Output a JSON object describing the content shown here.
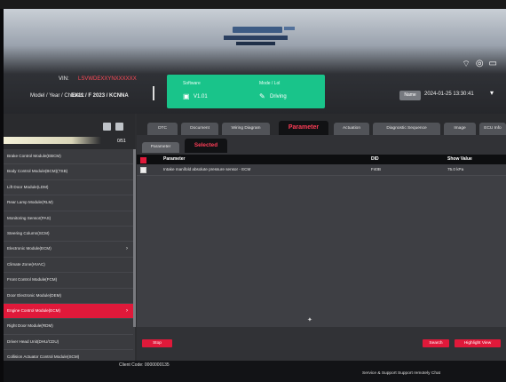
{
  "header": {
    "vin_label": "VIN:",
    "vin_value": "LSVWDEXXYNXXXXXX",
    "model_label": "Model / Year / Chassis:",
    "model_value": "EX11 / F 2023 / KCNNA",
    "system_icons": [
      "wifi-icon",
      "camera-icon",
      "battery-icon"
    ],
    "sys_text": "Ⓐ ◎ ▭"
  },
  "status_panel": {
    "software_title": "Software",
    "software_value": "V1.01",
    "mode_title": "Mode / Lol",
    "mode_value": "Driving",
    "color": "#19c48a"
  },
  "datetime": {
    "name_button": "Name",
    "value": "2024-01-25 13:30:41"
  },
  "left_panel": {
    "count": "0/51",
    "modules": [
      {
        "label": "Brake Control Module(EBCM)",
        "selected": false
      },
      {
        "label": "Body Control Module(BCM)(TSB)",
        "selected": false
      },
      {
        "label": "Lift Door Module(LDM)",
        "selected": false
      },
      {
        "label": "Rear Lamp Module(RLM)",
        "selected": false
      },
      {
        "label": "Monitoring Sensor(PAS)",
        "selected": false
      },
      {
        "label": "Steering Column(SCM)",
        "selected": false
      },
      {
        "label": "Electronic Module(ECM)",
        "selected": false
      },
      {
        "label": "Climate Zone(HVAC)",
        "selected": false
      },
      {
        "label": "Front Control Module(FCM)",
        "selected": false
      },
      {
        "label": "Door Electronic Module(DEM)",
        "selected": false
      },
      {
        "label": "Engine Control Module(ECM)",
        "selected": true
      },
      {
        "label": "Right Door Module(RDM)",
        "selected": false
      },
      {
        "label": "Driver Head Unit(DHU/CDU)",
        "selected": false
      },
      {
        "label": "Collision Actuator Control Module(SCM)",
        "selected": false
      },
      {
        "label": "Infotainment Head Unit(IHU)",
        "selected": false
      }
    ]
  },
  "tabs": [
    {
      "label": "DTC",
      "active": false
    },
    {
      "label": "Document",
      "active": false
    },
    {
      "label": "Wiring Diagram",
      "active": false
    },
    {
      "label": "Parameter",
      "active": true
    },
    {
      "label": "Actuation",
      "active": false
    },
    {
      "label": "Diagnostic Sequence",
      "active": false
    },
    {
      "label": "Image",
      "active": false
    },
    {
      "label": "ECU Info",
      "active": false
    }
  ],
  "subtabs": {
    "first": "Parameter",
    "second": "Selected"
  },
  "table": {
    "col_parameter": "Parameter",
    "col_did": "DID",
    "col_value": "Show Value",
    "rows": [
      {
        "parameter": "Intake manifold absolute pressure sensor - ECM",
        "did": "F40B",
        "value": "75.0 kPa"
      }
    ]
  },
  "buttons": {
    "stop": "Stop",
    "search": "Search",
    "highlight": "Highlight View"
  },
  "footer": {
    "client_code": "Client Code: 0000000135",
    "links": "Service & Support   Support remotely   Chat"
  },
  "colors": {
    "accent_red": "#e0193a",
    "status_green": "#19c48a",
    "active_tab_text": "#ff3d57"
  }
}
